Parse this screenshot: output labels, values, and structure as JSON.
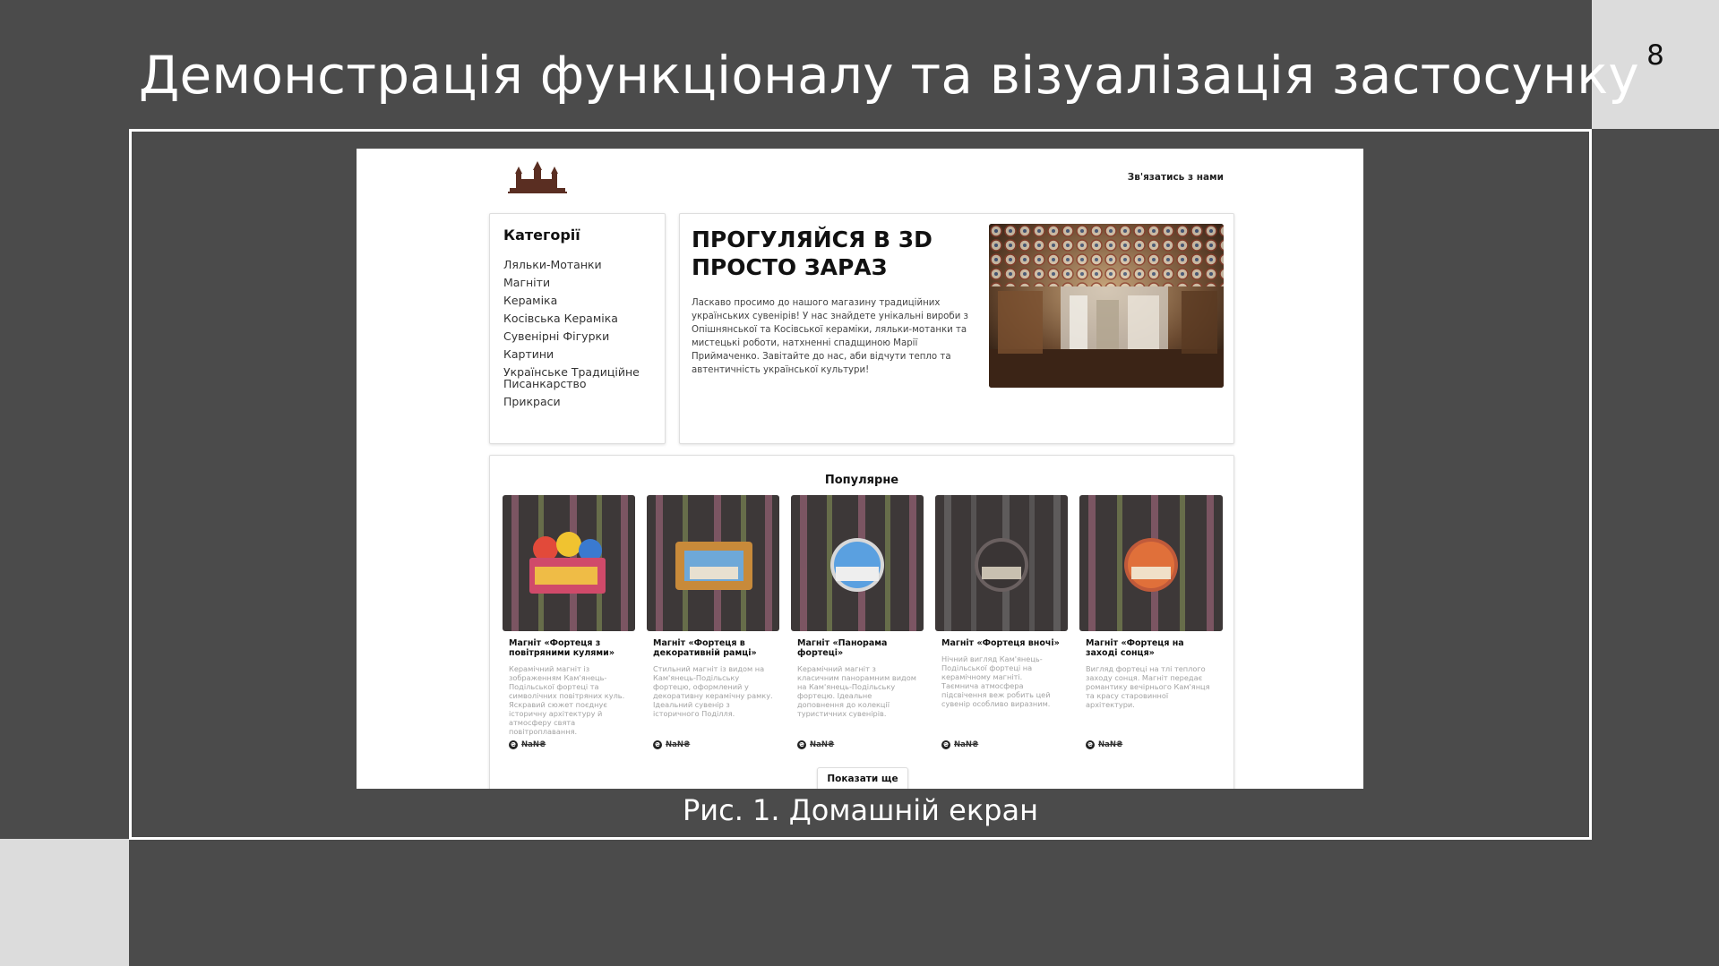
{
  "slide": {
    "title": "Демонстрація функціоналу та візуалізація застосунку",
    "number": "8",
    "caption": "Рис. 1. Домашній екран"
  },
  "site": {
    "logo_icon": "castle-logo-icon",
    "contact_link": "Зв'язатись з нами",
    "categories": {
      "title": "Категорії",
      "items": [
        "Ляльки-Мотанки",
        "Магніти",
        "Кераміка",
        "Косівська Кераміка",
        "Сувенірні Фігурки",
        "Картини",
        "Українське Традиційне Писанкарство",
        "Прикраси"
      ]
    },
    "hero": {
      "title": "ПРОГУЛЯЙСЯ В 3D ПРОСТО ЗАРАЗ",
      "text": "Ласкаво просимо до нашого магазину традиційних українських сувенірів! У нас знайдете унікальні вироби з Опішнянської та Косівської кераміки, ляльки-мотанки та мистецькі роботи, натхненні спадщиною Марії Приймаченко. Завітайте до нас, аби відчути тепло та автентичність української культури!"
    },
    "popular": {
      "title": "Популярне",
      "more_button": "Показати ще",
      "products": [
        {
          "name": "Магніт «Фортеця з повітряними кулями»",
          "description": "Керамічний магніт із зображенням Кам'янець-Подільської фортеці та символічних повітряних куль. Яскравий сюжет поєднує історичну архітектуру й атмосферу свята повітроплавання.",
          "price": "NaN₴"
        },
        {
          "name": "Магніт «Фортеця в декоративній рамці»",
          "description": "Стильний магніт із видом на Кам'янець-Подільську фортецю, оформлений у декоративну керамічну рамку. Ідеальний сувенір з історичного Поділля.",
          "price": "NaN₴"
        },
        {
          "name": "Магніт «Панорама фортеці»",
          "description": "Керамічний магніт з класичним панорамним видом на Кам'янець-Подільську фортецю. Ідеальне доповнення до колекції туристичних сувенірів.",
          "price": "NaN₴"
        },
        {
          "name": "Магніт «Фортеця вночі»",
          "description": "Нічний вигляд Кам'янець-Подільської фортеці на керамічному магніті. Таємнича атмосфера підсвічення веж робить цей сувенір особливо виразним.",
          "price": "NaN₴"
        },
        {
          "name": "Магніт «Фортеця на заході сонця»",
          "description": "Вигляд фортеці на тлі теплого заходу сонця. Магніт передає романтику вечірнього Кам'янця та красу старовинної архітектури.",
          "price": "NaN₴"
        }
      ]
    }
  }
}
